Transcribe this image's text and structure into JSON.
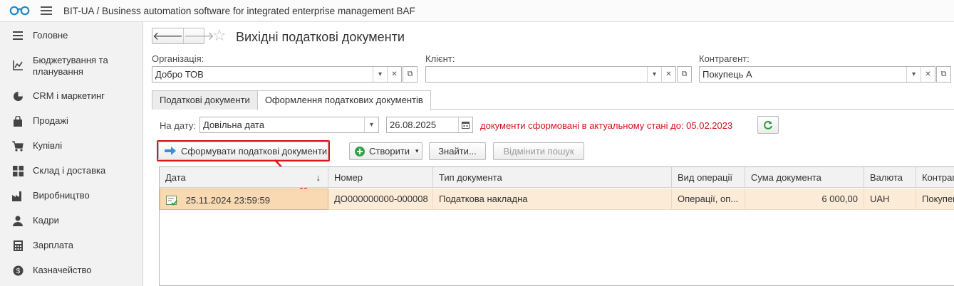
{
  "app": {
    "title": "BIT-UA / Business automation software for integrated enterprise management BAF"
  },
  "sidebar": {
    "items": [
      {
        "label": "Головне",
        "icon": "menu-lines-icon"
      },
      {
        "label": "Бюджетування та планування",
        "icon": "chart-line-icon"
      },
      {
        "label": "CRM і маркетинг",
        "icon": "pie-chart-icon"
      },
      {
        "label": "Продажі",
        "icon": "shopping-bag-icon"
      },
      {
        "label": "Купівлі",
        "icon": "cart-icon"
      },
      {
        "label": "Склад і доставка",
        "icon": "warehouse-grid-icon"
      },
      {
        "label": "Виробництво",
        "icon": "factory-icon"
      },
      {
        "label": "Кадри",
        "icon": "person-icon"
      },
      {
        "label": "Зарплата",
        "icon": "calculator-icon"
      },
      {
        "label": "Казначейство",
        "icon": "coin-icon"
      }
    ]
  },
  "page": {
    "title": "Вихідні податкові документи"
  },
  "filters": {
    "organization": {
      "label": "Організація:",
      "value": "Добро ТОВ"
    },
    "client": {
      "label": "Клієнт:",
      "value": ""
    },
    "counterparty": {
      "label": "Контрагент:",
      "value": "Покупець А"
    }
  },
  "tabs": [
    {
      "label": "Податкові документи",
      "active": false
    },
    {
      "label": "Оформлення податкових документів",
      "active": true
    }
  ],
  "date_filter": {
    "label": "На дату:",
    "mode": "Довільна дата",
    "date": "26.08.2025",
    "note": "документи сформовані в актуальному стані до:  05.02.2023"
  },
  "toolbar": {
    "generate": "Сформувати податкові документи",
    "create": "Створити",
    "find": "Знайти...",
    "cancel_search": "Відмінити пошук"
  },
  "table": {
    "columns": [
      "Дата",
      "Номер",
      "Тип документа",
      "Вид операції",
      "Сума документа",
      "Валюта",
      "Контрагент"
    ],
    "sort_indicator": "↓",
    "rows": [
      {
        "date": "25.11.2024 23:59:59",
        "number": "ДО000000000-000008",
        "type": "Податкова накладна",
        "operation": "Операції, оп...",
        "amount": "6 000,00",
        "currency": "UAH",
        "counterparty": "Покупець А"
      }
    ]
  },
  "colors": {
    "highlight_red": "#e0151b",
    "selected_row": "#fbebd7",
    "note_red": "#d0121b"
  }
}
